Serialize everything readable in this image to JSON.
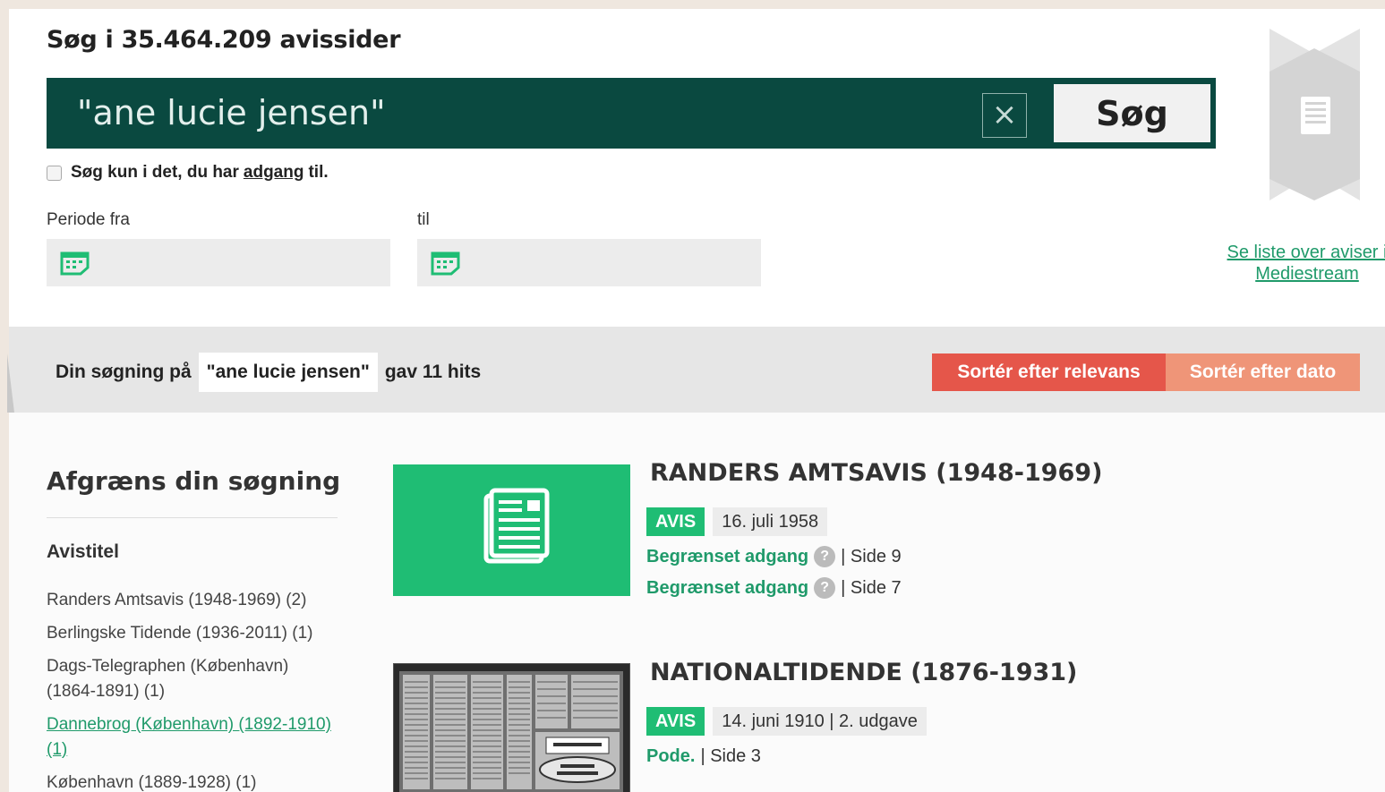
{
  "search": {
    "title": "Søg i 35.464.209 avissider",
    "query": "\"ane lucie jensen\"",
    "clear_label": "×",
    "button_label": "Søg",
    "only_access_prefix": "Søg kun i det, du har",
    "only_access_link": "adgang",
    "only_access_suffix": "til.",
    "period_from_label": "Periode fra",
    "period_to_label": "til",
    "calendar_icon": "calendar-icon"
  },
  "sidebar_link": {
    "line1": "Se liste over aviser i",
    "line2": "Mediestream"
  },
  "hits": {
    "prefix": "Din søgning på",
    "query": "\"ane lucie jensen\"",
    "suffix": "gav 11 hits",
    "sort_relevance": "Sortér efter relevans",
    "sort_date": "Sortér efter dato"
  },
  "facets": {
    "title": "Afgræns din søgning",
    "group": "Avistitel",
    "items": [
      {
        "label": "Randers Amtsavis (1948-1969) (2)"
      },
      {
        "label": "Berlingske Tidende (1936-2011) (1)"
      },
      {
        "label": "Dags-Telegraphen (København) (1864-1891) (1)"
      },
      {
        "label": "Dannebrog (København) (1892-1910) (1)"
      },
      {
        "label": "København (1889-1928) (1)"
      }
    ]
  },
  "results": [
    {
      "title": "RANDERS AMTSAVIS (1948-1969)",
      "badge": "AVIS",
      "date": "16. juli 1958",
      "lines": [
        {
          "access": "Begrænset adgang",
          "help": "?",
          "page": "| Side 9"
        },
        {
          "access": "Begrænset adgang",
          "help": "?",
          "page": "| Side 7"
        }
      ]
    },
    {
      "title": "NATIONALTIDENDE (1876-1931)",
      "badge": "AVIS",
      "date": "14. juni 1910 | 2. udgave",
      "lines": [
        {
          "access": "Pode.",
          "page": "| Side 3"
        }
      ]
    }
  ],
  "colors": {
    "search_bar": "#0a4940",
    "accent_green": "#1fbd74",
    "link_green": "#1f9a6a",
    "sort_relevance": "#e5564a",
    "sort_date": "#ef9578"
  }
}
